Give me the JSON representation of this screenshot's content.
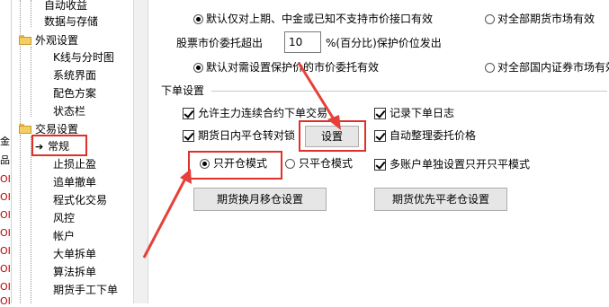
{
  "left_strip": {
    "items": [
      {
        "text": "金",
        "red": false
      },
      {
        "text": "品",
        "red": false
      },
      {
        "text": "OI",
        "red": true
      },
      {
        "text": "OI",
        "red": true
      },
      {
        "text": "OI",
        "red": true
      },
      {
        "text": "OI",
        "red": true
      },
      {
        "text": "OI",
        "red": true
      },
      {
        "text": "OI",
        "red": true
      },
      {
        "text": "OI",
        "red": true
      },
      {
        "text": "OI",
        "red": true
      }
    ]
  },
  "tree": {
    "items": [
      {
        "label": "自动收益",
        "level": 2
      },
      {
        "label": "数据与存储",
        "level": 2
      },
      {
        "label": "外观设置",
        "level": 1
      },
      {
        "label": "K线与分时图",
        "level": 2
      },
      {
        "label": "系统界面",
        "level": 2
      },
      {
        "label": "配色方案",
        "level": 2
      },
      {
        "label": "状态栏",
        "level": 2
      },
      {
        "label": "交易设置",
        "level": 1
      },
      {
        "label": "常规",
        "level": 2,
        "selected": true
      },
      {
        "label": "止损止盈",
        "level": 2
      },
      {
        "label": "追单撤单",
        "level": 2
      },
      {
        "label": "程式化交易",
        "level": 2
      },
      {
        "label": "风控",
        "level": 2
      },
      {
        "label": "帐户",
        "level": 2
      },
      {
        "label": "大单拆单",
        "level": 2
      },
      {
        "label": "算法拆单",
        "level": 2
      },
      {
        "label": "期货手工下单",
        "level": 2
      }
    ]
  },
  "settings": {
    "radio_row1": {
      "option_a": "默认仅对上期、中金或已知不支持市价接口有效",
      "option_a_checked": true,
      "option_b": "对全部期货市场有效",
      "option_b_checked": false
    },
    "stock_market": {
      "label": "股票市价委托超出",
      "value": "10",
      "suffix": "%(百分比)保护价位发出"
    },
    "radio_row2": {
      "option_a": "默认对需设置保护价的市价委托有效",
      "option_a_checked": true,
      "option_b": "对全部国内证券市场有效",
      "option_b_checked": false
    },
    "section_title": "下单设置",
    "checkboxes": [
      {
        "label": "允许主力连续合约下单交易",
        "checked": true
      },
      {
        "label": "记录下单日志",
        "checked": true
      },
      {
        "label": "期货日内平仓转对锁",
        "checked": true
      },
      {
        "label": "自动整理委托价格",
        "checked": true
      },
      {
        "label": "多账户单独设置只开只平模式",
        "checked": true
      }
    ],
    "setup_button": "设置",
    "mode_radios": [
      {
        "label": "只开仓模式",
        "checked": true
      },
      {
        "label": "只平仓模式",
        "checked": false
      }
    ],
    "buttons": {
      "rollover": "期货换月移仓设置",
      "priority_close": "期货优先平老仓设置"
    }
  },
  "colors": {
    "highlight_red": "#e0302a",
    "arrow_red": "#e6403a",
    "folder_yellow": "#f5cd62"
  }
}
